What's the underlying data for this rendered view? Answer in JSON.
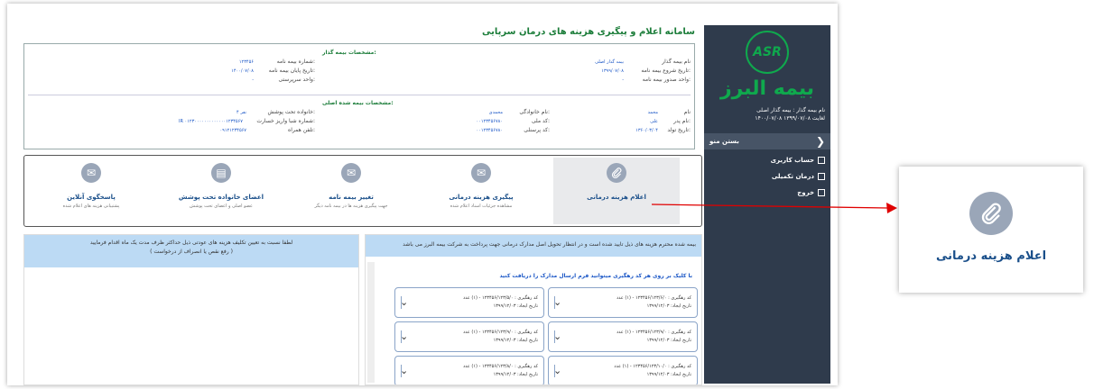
{
  "header": {
    "title": "سامانه اعلام و پیگیری هزینه های درمان سرپایی"
  },
  "sidebar": {
    "logo_mark": "ASR",
    "logo_text": "بیمه البرز",
    "info_line1": "نام بیمه گذار : بیمه گذار اصلی",
    "info_line2": "۱۴۰۰/۰۷/۰۸ لغایت ۱۳۹۹/۰۷/۰۸",
    "menu_label": "بستن منو",
    "items": [
      {
        "label": "حساب کاربری"
      },
      {
        "label": "درمان تکمیلی"
      },
      {
        "label": "خروج"
      }
    ]
  },
  "insurer": {
    "section_title": "مشخصات بیمه گذار:",
    "fields": [
      {
        "label": "نام بیمه گذار",
        "value": "بیمه گذار اصلی"
      },
      {
        "label": "تاریخ شروع بیمه نامه:",
        "value": "۱۳۹۹/۰۷/۰۸"
      },
      {
        "label": "واحد صدور بیمه نامه:",
        "value": "-"
      },
      {
        "label": "شماره بیمه نامه:",
        "value": "۱۲۳۴۵۶"
      },
      {
        "label": "تاریخ پایان بیمه نامه:",
        "value": "۱۴۰۰/۰۷/۰۸"
      },
      {
        "label": "واحد سرپرستی:",
        "value": "-"
      }
    ]
  },
  "insured": {
    "section_title": "مشخصات بیمه شده اصلی:",
    "fields": [
      {
        "label": "نام",
        "value": "محمد"
      },
      {
        "label": "نام پدر:",
        "value": "علی"
      },
      {
        "label": "تاریخ تولد:",
        "value": "۱۳۶۰/۰۳/۰۴"
      },
      {
        "label": "نام خانوادگی:",
        "value": "محمدی"
      },
      {
        "label": "کد ملی:",
        "value": "۰۰۱۲۳۴۵۶۷۸۰"
      },
      {
        "label": "کد پرسنلی:",
        "value": "۰۰۱۲۳۴۵۶۷۸۰"
      },
      {
        "label": "خانواده تحت پوشش:",
        "value": "۴ نفر"
      },
      {
        "label": "شماره شبا واریز خسارت:",
        "value": "IR ۰۱۲۳۰۰۰۰۰۰۰۰۰۰۰۰۰۱۲۳۴۵۶۷"
      },
      {
        "label": "تلفن همراه:",
        "value": "۰۹۱۲۱۲۳۴۵۶۷"
      }
    ]
  },
  "cards": [
    {
      "title": "اعلام هزینه درمانی",
      "subtitle": "",
      "icon": "paperclip-icon"
    },
    {
      "title": "پیگیری هزینه درمانی",
      "subtitle": "مشاهده جزئیات اسناد اعلام شده",
      "icon": "mail-icon"
    },
    {
      "title": "تغییر بیمه نامه",
      "subtitle": "جهت پیگیری هزینه ها در بیمه نامه دیگر",
      "icon": "mail-icon"
    },
    {
      "title": "اعضای خانواده تحت پوشش",
      "subtitle": "عضو اصلی و اعضای تحت پوشش",
      "icon": "document-icon"
    },
    {
      "title": "پاسخگوی آنلاین",
      "subtitle": "پشتیبانی هزینه های اعلام شده",
      "icon": "chat-icon"
    }
  ],
  "left_panel": {
    "line1": "لطفا نسبت به تعیین تکلیف هزینه های عودتی ذیل حداکثر ظرف مدت یک ماه اقدام فرمایید",
    "line2": "( رفع نقص یا انصراف از درخواست )"
  },
  "right_panel": {
    "header": "بیمه شده محترم هزینه های ذیل تایید شده است و در انتظار تحویل اصل مدارک درمانی جهت پرداخت به شرکت بیمه البرز می باشد",
    "subtext": "با کلیک بر روی هر کد رهگیری میتوانید فرم ارسال مدارک را دریافت کنید",
    "tracking": [
      {
        "code": "کد رهگیری : ۱۲۳۴۵۶/۱۲۳/۶/۰ - (۱) عدد",
        "date": "تاریخ ایجاد: ۱۳۹۹/۱۲/۰۳"
      },
      {
        "code": "کد رهگیری : ۱۲۳۴۵۶/۱۲۳/۵/۰ - (۱) عدد",
        "date": "تاریخ ایجاد: ۱۳۹۹/۱۲/۰۳"
      },
      {
        "code": "کد رهگیری : ۱۲۳۴۵۶/۱۲۳/۹/۰ - (۱) عدد",
        "date": "تاریخ ایجاد: ۱۳۹۹/۱۲/۰۳"
      },
      {
        "code": "کد رهگیری : ۱۲۳۴۵۶/۱۲۳/۹/۰ - (۱) عدد",
        "date": "تاریخ ایجاد: ۱۳۹۹/۱۲/۰۳"
      },
      {
        "code": "کد رهگیری : ۱۲۳۴۵۶/۱۲۳/۱۰/۰ - (۱) عدد",
        "date": "تاریخ ایجاد: ۱۳۹۹/۱۲/۰۳"
      },
      {
        "code": "کد رهگیری : ۱۲۳۴۵۶/۱۲۳/۸/۰ - (۱) عدد",
        "date": "تاریخ ایجاد: ۱۳۹۹/۱۲/۰۳"
      }
    ]
  },
  "zoom": {
    "label": "اعلام هزینه درمانی",
    "icon": "paperclip-icon"
  },
  "colors": {
    "sidebar": "#2f3b4c",
    "brand_green": "#0fa94d",
    "panel_blue": "#bcdaf4",
    "arrow_red": "#e00000"
  }
}
